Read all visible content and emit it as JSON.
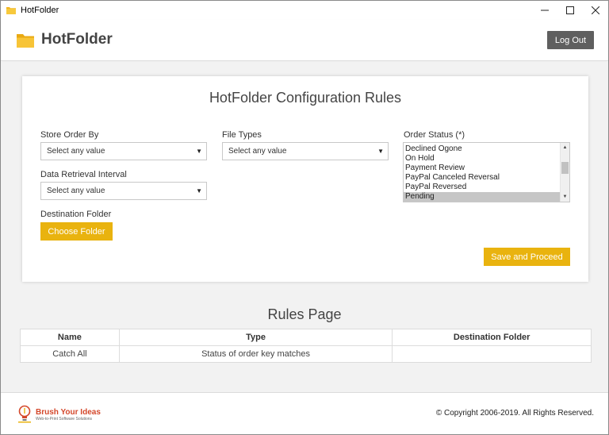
{
  "window": {
    "title": "HotFolder",
    "controls": {
      "minimize": "─",
      "maximize": "☐",
      "close": "✕"
    }
  },
  "header": {
    "title": "HotFolder",
    "logout_label": "Log Out"
  },
  "config": {
    "title": "HotFolder Configuration Rules",
    "store_order_by": {
      "label": "Store Order By",
      "value": "Select any value"
    },
    "file_types": {
      "label": "File Types",
      "value": "Select any value"
    },
    "data_retrieval_interval": {
      "label": "Data Retrieval Interval",
      "value": "Select any value"
    },
    "destination_folder": {
      "label": "Destination Folder",
      "button": "Choose Folder"
    },
    "order_status": {
      "label": "Order Status (*)",
      "options": [
        "Declined Ogone",
        "On Hold",
        "Payment Review",
        "PayPal Canceled Reversal",
        "PayPal Reversed",
        "Pending"
      ],
      "selected": "Pending"
    },
    "save_label": "Save and Proceed"
  },
  "rules": {
    "title": "Rules Page",
    "columns": [
      "Name",
      "Type",
      "Destination Folder"
    ],
    "rows": [
      [
        "Catch All",
        "Status of order key matches",
        ""
      ]
    ]
  },
  "footer": {
    "brand_name": "Brush Your Ideas",
    "brand_tagline": "Web-to-Print Software Solutions",
    "copyright": "© Copyright 2006-2019. All Rights Reserved."
  },
  "colors": {
    "accent": "#e9b30f",
    "logout_bg": "#5f5f5f",
    "folder": "#f2b51e",
    "brand": "#d4472a"
  },
  "icons": {
    "app": "folder-icon",
    "dropdown": "chevron-down-icon",
    "brand": "lightbulb-icon"
  }
}
